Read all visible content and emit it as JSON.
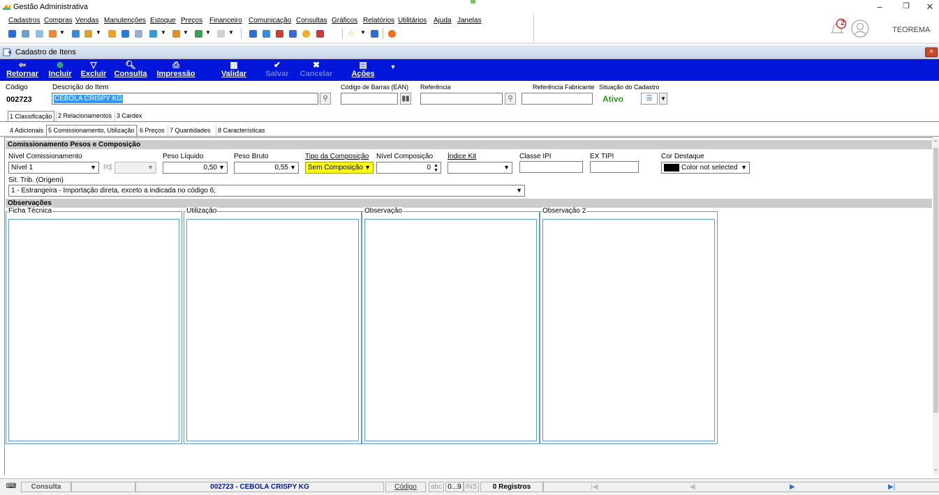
{
  "window": {
    "title": "Gestão Administrativa",
    "user": "TEOREMA",
    "notifications": "2"
  },
  "menu": [
    "Cadastros",
    "Compras",
    "Vendas",
    "Manutenções",
    "Estoque",
    "Preços",
    "Financeiro",
    "Comunicação",
    "Consultas",
    "Gráficos",
    "Relatórios",
    "Utilitários",
    "Ajuda",
    "Janelas"
  ],
  "subwindow": {
    "title": "Cadastro de Itens",
    "close": "×"
  },
  "toolbar": {
    "retornar": "Retornar",
    "incluir": "Incluir",
    "excluir": "Excluir",
    "consulta": "Consulta",
    "impressao": "Impressão",
    "validar": "Validar",
    "salvar": "Salvar",
    "cancelar": "Cancelar",
    "acoes": "Ações"
  },
  "header": {
    "codigo_label": "Código",
    "codigo": "002723",
    "descricao_label": "Descrição do Item",
    "descricao": "CEBOLA CRISPY KG",
    "ean_label": "Código de Barras (EAN)",
    "ean": "",
    "referencia_label": "Referência",
    "referencia": "",
    "ref_fab_label": "Referência Fabricante",
    "ref_fab": "",
    "situacao_label": "Situação do Cadastro",
    "situacao": "Ativo"
  },
  "tabs_row1": [
    "1 Classificação",
    "2 Relacionamentos",
    "3 Cardex"
  ],
  "tabs_row2": [
    "4 Adicionais",
    "5 Comissionamento, Utilização",
    "6 Preços",
    "7 Quantidades",
    "8 Características"
  ],
  "section1": {
    "title": "Comissionamento Pesos e Composição",
    "nivel_com_label": "Nível Comissionamento",
    "nivel_com": "Nível 1",
    "rs_label": "R$",
    "peso_liq_label": "Peso Líquido",
    "peso_liq": "0,50",
    "peso_bruto_label": "Peso Bruto",
    "peso_bruto": "0,55",
    "tipo_comp_label": "Tipo da Composição",
    "tipo_comp": "Sem Composição",
    "nivel_comp_label": "Nível Composição",
    "nivel_comp": "0",
    "indice_kit_label": "Índice Kit",
    "indice_kit": "",
    "classe_ipi_label": "Classe IPI",
    "classe_ipi": "",
    "ex_tipi_label": "EX TIPI",
    "ex_tipi": "",
    "cor_label": "Cor Destaque",
    "cor": "Color not selected",
    "sit_trib_label": "Sit. Trib. (Origem)",
    "sit_trib": "1 - Estrangeira - Importação direta, exceto a indicada no código 6;"
  },
  "section2": {
    "title": "Observações",
    "memos": [
      "Ficha Técnica",
      "Utilização",
      "Observação",
      "Observação 2"
    ]
  },
  "status": {
    "mode": "Consulta",
    "record": "002723 - CEBOLA CRISPY KG",
    "field": "Código",
    "abc": "abc",
    "nums": "0...9",
    "ins": "INS",
    "registros": "0 Registros"
  },
  "colors": {
    "toolbar_bg": "#0016d8",
    "status_active": "#2e9a1a",
    "highlight": "#ffff00",
    "selection": "#3399ff"
  }
}
